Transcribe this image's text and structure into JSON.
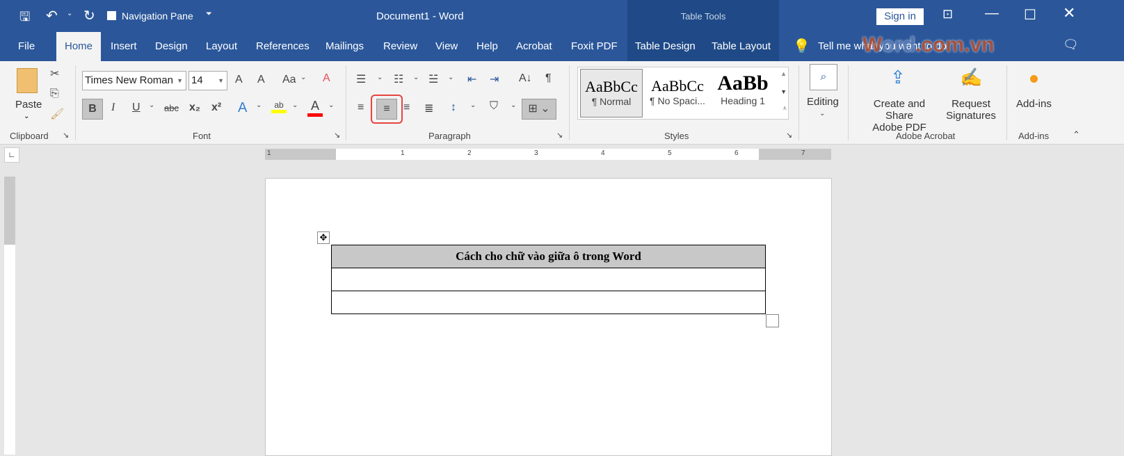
{
  "titlebar": {
    "title": "Document1  -  Word",
    "quick_access": {
      "nav_pane_label": "Navigation Pane",
      "nav_pane_checked": false
    },
    "context_title": "Table Tools",
    "sign_in": "Sign in"
  },
  "tabs": [
    {
      "label": "File"
    },
    {
      "label": "Home",
      "active": true
    },
    {
      "label": "Insert"
    },
    {
      "label": "Design"
    },
    {
      "label": "Layout"
    },
    {
      "label": "References"
    },
    {
      "label": "Mailings"
    },
    {
      "label": "Review"
    },
    {
      "label": "View"
    },
    {
      "label": "Help"
    },
    {
      "label": "Acrobat"
    },
    {
      "label": "Foxit PDF"
    },
    {
      "label": "Table Design"
    },
    {
      "label": "Table Layout"
    }
  ],
  "tell_me": "Tell me what you want to do",
  "watermark": "Word.com.vn",
  "ribbon": {
    "clipboard": {
      "paste": "Paste",
      "label": "Clipboard"
    },
    "font": {
      "name": "Times New Roman",
      "size": "14",
      "label": "Font",
      "bold": "B",
      "italic": "I",
      "underline": "U",
      "strike": "abc",
      "sub": "x₂",
      "sup": "x²",
      "grow": "A",
      "shrink": "A",
      "case": "Aa",
      "highlight_color": "#ffff00",
      "font_color": "#ff0000"
    },
    "paragraph": {
      "label": "Paragraph",
      "active_alignment": "center"
    },
    "styles": {
      "label": "Styles",
      "items": [
        {
          "preview": "AaBbCc",
          "name": "¶ Normal"
        },
        {
          "preview": "AaBbCc",
          "name": "¶ No Spaci..."
        },
        {
          "preview": "AaBb",
          "name": "Heading 1"
        }
      ]
    },
    "editing": {
      "label": "Editing"
    },
    "acrobat": {
      "label": "Adobe Acrobat",
      "create": "Create and Share",
      "create2": "Adobe PDF",
      "request": "Request",
      "request2": "Signatures"
    },
    "addins": {
      "label": "Add-ins",
      "button": "Add-ins"
    }
  },
  "ruler": {
    "marks": [
      "1",
      "1",
      "2",
      "3",
      "4",
      "5",
      "6",
      "7"
    ]
  },
  "document": {
    "table": {
      "rows": [
        [
          "Cách cho chữ vào giữa ô trong Word"
        ],
        [
          ""
        ],
        [
          ""
        ]
      ],
      "header_shading": "#c8c8c8"
    }
  },
  "colors": {
    "brand": "#2b579a",
    "highlight_border": "#e8433f"
  }
}
